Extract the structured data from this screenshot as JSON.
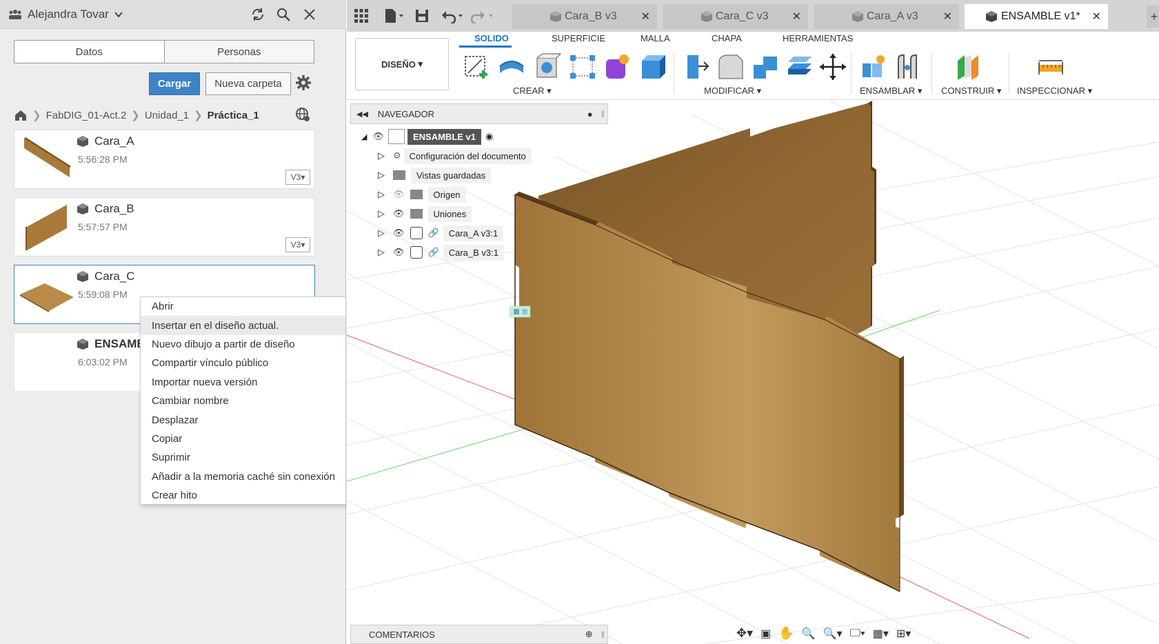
{
  "data_panel": {
    "user_name": "Alejandra Tovar",
    "tabs": [
      "Datos",
      "Personas"
    ],
    "upload_label": "Cargar",
    "new_folder_label": "Nueva carpeta",
    "breadcrumb": [
      "FabDIG_01-Act.2",
      "Unidad_1",
      "Práctica_1"
    ],
    "files": [
      {
        "name": "Cara_A",
        "time": "5:56:28 PM",
        "version": "V3"
      },
      {
        "name": "Cara_B",
        "time": "5:57:57 PM",
        "version": "V3"
      },
      {
        "name": "Cara_C",
        "time": "5:59:08 PM",
        "version": ""
      },
      {
        "name": "ENSAMBLE",
        "time": "6:03:02 PM",
        "version": ""
      }
    ]
  },
  "context_menu": {
    "items": [
      "Abrir",
      "Insertar en el diseño actual.",
      "Nuevo dibujo a partir de diseño",
      "Compartir vínculo público",
      "Importar nueva versión",
      "Cambiar nombre",
      "Desplazar",
      "Copiar",
      "Suprimir",
      "Añadir a la memoria caché sin conexión",
      "Crear hito"
    ],
    "highlighted": 1
  },
  "tabs": [
    {
      "label": "Cara_B v3",
      "active": false
    },
    {
      "label": "Cara_C v3",
      "active": false
    },
    {
      "label": "Cara_A v3",
      "active": false
    },
    {
      "label": "ENSAMBLE v1*",
      "active": true
    }
  ],
  "toolbar": {
    "workspace": "DISEÑO",
    "ribbon_tabs": [
      "SOLIDO",
      "SUPERFICIE",
      "MALLA",
      "CHAPA",
      "HERRAMIENTAS"
    ],
    "groups": [
      "CREAR",
      "MODIFICAR",
      "ENSAMBLAR",
      "CONSTRUIR",
      "INSPECCIONAR"
    ]
  },
  "browser": {
    "title": "NAVEGADOR",
    "root": "ENSAMBLE v1",
    "items": [
      "Configuración del documento",
      "Vistas guardadas",
      "Origen",
      "Uniones",
      "Cara_A v3:1",
      "Cara_B v3:1"
    ]
  },
  "comments_label": "COMENTARIOS",
  "colors": {
    "accent": "#1a73c7",
    "upload": "#3d84c6",
    "wood": "#b88b4a"
  }
}
